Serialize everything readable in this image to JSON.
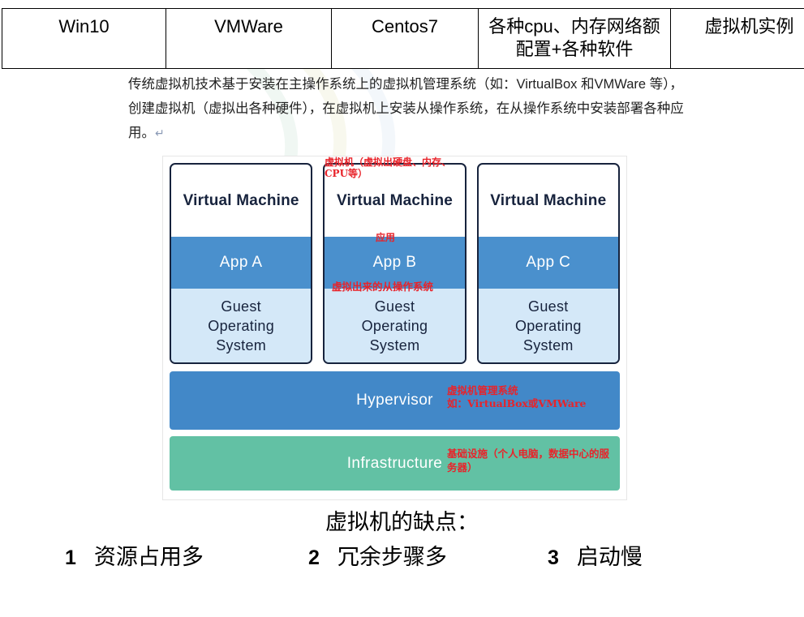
{
  "spec_table": {
    "row": [
      {
        "cell": "Win10"
      },
      {
        "cell": "VMWare"
      },
      {
        "cell": "Centos7"
      },
      {
        "cell": "各种cpu、内存网络额配置+各种软件"
      },
      {
        "cell": "虚拟机实例"
      }
    ]
  },
  "intro": {
    "paragraph": "传统虚拟机技术基于安装在主操作系统上的虚拟机管理系统（如：VirtualBox 和VMWare 等），创建虚拟机（虚拟出各种硬件），在虚拟机上安装从操作系统，在从操作系统中安装部署各种应用。",
    "pilcrow": "↵"
  },
  "diagram": {
    "vms": [
      {
        "title": "Virtual Machine",
        "app": "App A",
        "guest": "Guest\nOperating\nSystem"
      },
      {
        "title": "Virtual Machine",
        "app": "App B",
        "guest": "Guest\nOperating\nSystem"
      },
      {
        "title": "Virtual Machine",
        "app": "App C",
        "guest": "Guest\nOperating\nSystem"
      }
    ],
    "hypervisor_label": "Hypervisor",
    "infrastructure_label": "Infrastructure",
    "annotations": {
      "vm_hardware": "虚拟机（虚拟出硬盘、内存、CPU等）",
      "app": "应用",
      "guest_os": "虚拟出来的从操作系统",
      "hypervisor": "虚拟机管理系统\n如：VirtualBox或VMWare",
      "infrastructure": "基础设施（个人电脑，数据中心的服务器）"
    },
    "colors": {
      "app_band": "#4a90cd",
      "guest_band": "#d4e8f8",
      "hypervisor": "#4288c8",
      "infrastructure": "#62c1a4",
      "vm_border": "#17233d",
      "annotation": "#e8232a"
    }
  },
  "cons": {
    "title": "虚拟机的缺点：",
    "items": [
      {
        "num": "1",
        "text": "资源占用多"
      },
      {
        "num": "2",
        "text": "冗余步骤多"
      },
      {
        "num": "3",
        "text": "启动慢"
      }
    ]
  }
}
